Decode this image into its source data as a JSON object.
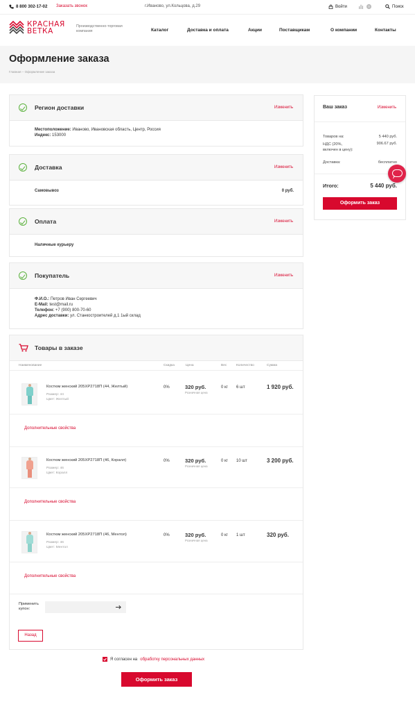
{
  "topbar": {
    "phone": "8 800 302-17-02",
    "callback": "Заказать звонок",
    "address": "г.Иваново, ул.Кольцова, д.29",
    "login": "Войти",
    "compare_count": "0",
    "search": "Поиск"
  },
  "header": {
    "logo_line1": "КРАСНАЯ",
    "logo_line2": "ВЕТКА",
    "tagline": "Производственно-торговая компания",
    "nav": [
      "Каталог",
      "Доставка и оплата",
      "Акции",
      "Поставщикам",
      "О компании",
      "Контакты"
    ]
  },
  "page": {
    "title": "Оформление заказа",
    "breadcrumbs": "Главная – Оформление заказа"
  },
  "region": {
    "title": "Регион доставки",
    "change": "Изменить",
    "location_label": "Местоположение:",
    "location_value": "Иваново, Ивановская область, Центр, Россия",
    "index_label": "Индекс:",
    "index_value": "153000"
  },
  "delivery": {
    "title": "Доставка",
    "change": "Изменить",
    "method": "Самовывоз",
    "price": "0 руб."
  },
  "payment": {
    "title": "Оплата",
    "change": "Изменить",
    "method": "Наличные курьеру"
  },
  "buyer": {
    "title": "Покупатель",
    "change": "Изменить",
    "fio_label": "Ф.И.О.:",
    "fio_value": "Петров Иван Сергеевич",
    "email_label": "E-Mail:",
    "email_value": "test@mail.ru",
    "phone_label": "Телефон:",
    "phone_value": "+7 (900) 800-70-60",
    "address_label": "Адрес доставки:",
    "address_value": "ул. Станкостроителей д.1 1ый склад"
  },
  "goods": {
    "title": "Товары в заказе",
    "columns": [
      "Наименование",
      "Скидка",
      "Цена",
      "Вес",
      "Количество",
      "Сумма"
    ],
    "items": [
      {
        "name": "Костюм женский 205ХР2718П (44, Желтый)",
        "size": "Размер: 44",
        "color": "Цвет: Желтый",
        "discount": "0%",
        "price": "320 руб.",
        "price_note": "Розничная цена",
        "weight": "0 кг",
        "qty": "6 шт",
        "sum": "1 920 руб.",
        "more": "Дополнительные свойства"
      },
      {
        "name": "Костюм женский 205ХР2718П (46, Коралл)",
        "size": "Размер: 46",
        "color": "Цвет: Коралл",
        "discount": "0%",
        "price": "320 руб.",
        "price_note": "Розничная цена",
        "weight": "0 кг",
        "qty": "10 шт",
        "sum": "3 200 руб.",
        "more": "Дополнительные свойства"
      },
      {
        "name": "Костюм женский 205ХР2718П (46, Ментол)",
        "size": "Размер: 46",
        "color": "Цвет: Ментол",
        "discount": "0%",
        "price": "320 руб.",
        "price_note": "Розничная цена",
        "weight": "0 кг",
        "qty": "1 шт",
        "sum": "320 руб.",
        "more": "Дополнительные свойства"
      }
    ],
    "coupon_label": "Применить купон:",
    "coupon_placeholder": "",
    "back": "Назад"
  },
  "summary": {
    "title": "Ваш заказ",
    "change": "Изменить",
    "items_label": "Товаров на:",
    "items_value": "5 440 руб.",
    "vat_label": "НДС (20%, включен в цену):",
    "vat_value": "906.67 руб.",
    "delivery_label": "Доставка:",
    "delivery_value": "бесплатно",
    "total_label": "Итого:",
    "total_value": "5 440 руб.",
    "submit": "Оформить заказ"
  },
  "footer": {
    "agree_text": "Я согласен на",
    "agree_link": "обработку персональных данных",
    "submit": "Оформить заказ"
  },
  "colors": {
    "accent": "#d8092e",
    "check": "#5cb23e"
  }
}
